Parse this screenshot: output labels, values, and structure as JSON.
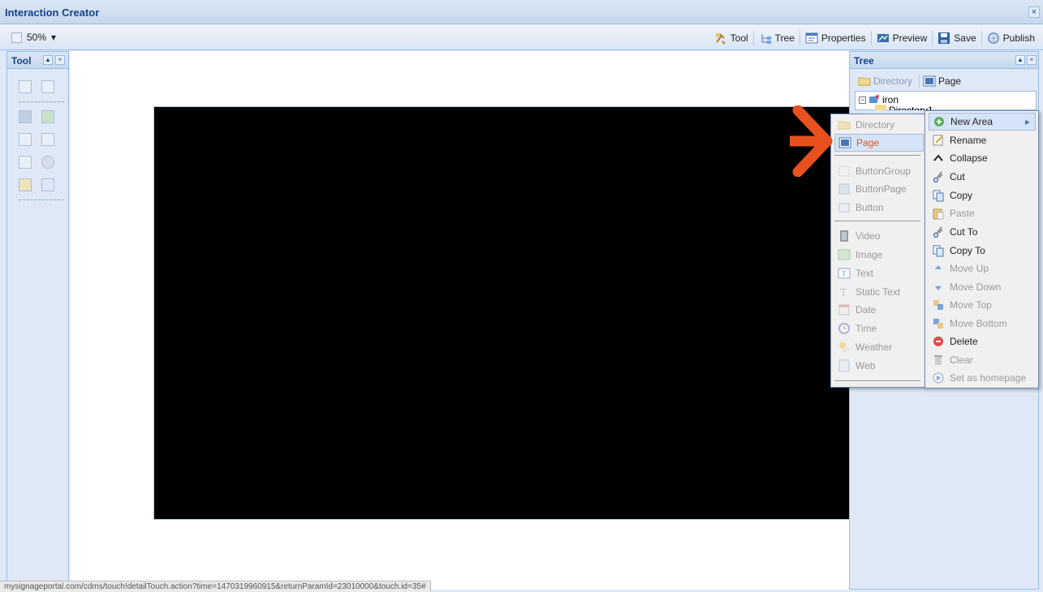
{
  "window": {
    "title": "Interaction Creator",
    "close_glyph": "×"
  },
  "toolbar": {
    "zoom": "50%",
    "dropdown_glyph": "▾",
    "items": [
      {
        "label": "Tool",
        "icon": "tool-icon"
      },
      {
        "label": "Tree",
        "icon": "tree-icon"
      },
      {
        "label": "Properties",
        "icon": "properties-icon"
      },
      {
        "label": "Preview",
        "icon": "preview-icon"
      },
      {
        "label": "Save",
        "icon": "save-icon"
      },
      {
        "label": "Publish",
        "icon": "publish-icon"
      }
    ]
  },
  "tool_panel": {
    "title": "Tool",
    "collapse_glyph": "▲",
    "close_glyph": "×"
  },
  "tree_panel": {
    "title": "Tree",
    "collapse_glyph": "▲",
    "close_glyph": "×",
    "buttons": {
      "directory": "Directory",
      "page": "Page"
    },
    "root_node": "iron",
    "child_node": "Directory1"
  },
  "submenu": {
    "items": [
      {
        "label": "Directory",
        "disabled": true
      },
      {
        "label": "Page",
        "highlighted": true
      },
      {
        "label": "ButtonGroup",
        "disabled": true
      },
      {
        "label": "ButtonPage",
        "disabled": true
      },
      {
        "label": "Button",
        "disabled": true
      },
      {
        "label": "Video",
        "disabled": true
      },
      {
        "label": "Image",
        "disabled": true
      },
      {
        "label": "Text",
        "disabled": true
      },
      {
        "label": "Static Text",
        "disabled": true
      },
      {
        "label": "Date",
        "disabled": true
      },
      {
        "label": "Time",
        "disabled": true
      },
      {
        "label": "Weather",
        "disabled": true
      },
      {
        "label": "Web",
        "disabled": true
      }
    ]
  },
  "context_menu": {
    "submenu_arrow_glyph": "▸",
    "items": [
      {
        "label": "New Area",
        "has_submenu": true
      },
      {
        "label": "Rename"
      },
      {
        "label": "Collapse"
      },
      {
        "label": "Cut"
      },
      {
        "label": "Copy"
      },
      {
        "label": "Paste",
        "disabled": true
      },
      {
        "label": "Cut To"
      },
      {
        "label": "Copy To"
      },
      {
        "label": "Move Up",
        "disabled": true
      },
      {
        "label": "Move Down",
        "disabled": true
      },
      {
        "label": "Move Top",
        "disabled": true
      },
      {
        "label": "Move Bottom",
        "disabled": true
      },
      {
        "label": "Delete"
      },
      {
        "label": "Clear",
        "disabled": true
      },
      {
        "label": "Set as homepage",
        "disabled": true
      }
    ]
  },
  "status_url": "mysignageportal.com/cdms/touch!detailTouch.action?time=1470319960915&returnParamId=23010000&touch.id=35#",
  "colors": {
    "accent": "#15428b",
    "arrow": "#e8501e",
    "stage": "#000000",
    "highlight_text": "#e8501e"
  }
}
